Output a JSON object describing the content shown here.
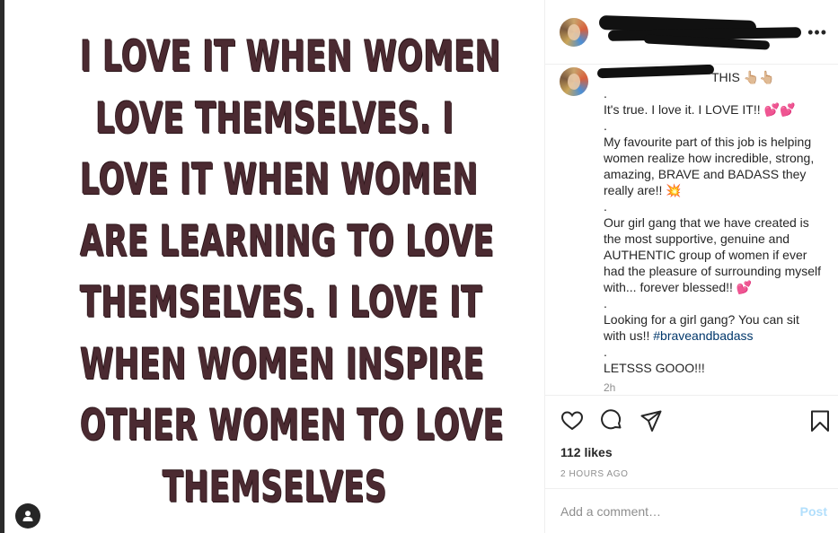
{
  "media": {
    "quote_lines": [
      "I LOVE IT WHEN WOMEN",
      "LOVE THEMSELVES. I",
      "LOVE IT WHEN WOMEN",
      "ARE LEARNING TO LOVE",
      "THEMSELVES. I LOVE IT",
      "WHEN WOMEN INSPIRE",
      "OTHER WOMEN TO LOVE",
      "THEMSELVES"
    ],
    "tag_icon": "user-tag-icon"
  },
  "header": {
    "more_label": "•••"
  },
  "caption": {
    "first_line_visible": "THIS 👆🏼👆🏼",
    "paragraphs": [
      ".",
      "It's true. I love it. I LOVE IT!! 💕💕",
      ".",
      "My favourite part of this job is helping women realize how incredible, strong, amazing, BRAVE and BADASS they really are!! 💥",
      ".",
      "Our girl gang that we have created is the most supportive, genuine and AUTHENTIC group of women if ever had the pleasure of surrounding myself with... forever blessed!! 💕",
      ".",
      "Looking for a girl gang? You can sit with us!!",
      ".",
      "LETSSS GOOO!!!"
    ],
    "hashtag": "#braveandbadass",
    "time_small": "2h"
  },
  "actions": {
    "icons": [
      "heart-icon",
      "comment-icon",
      "share-icon",
      "bookmark-icon"
    ]
  },
  "likes": "112 likes",
  "time": "2 HOURS AGO",
  "add_comment": {
    "placeholder": "Add a comment…",
    "post_label": "Post"
  },
  "colors": {
    "quote_text": "#4b2a31",
    "hashtag": "#00376b",
    "post_button": "#b2dffc"
  }
}
